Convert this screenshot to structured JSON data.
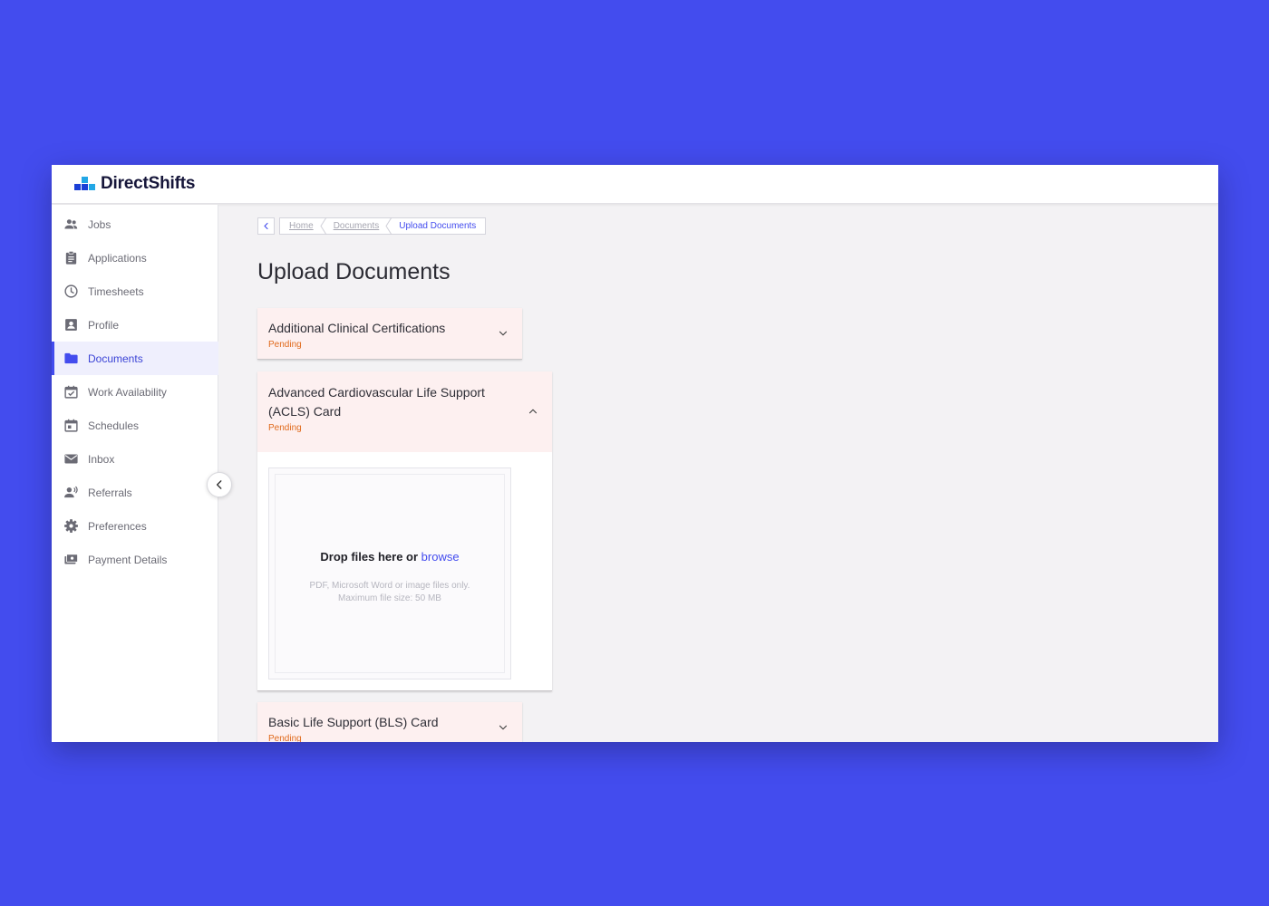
{
  "app": {
    "brand": "DirectShifts"
  },
  "sidebar": {
    "items": [
      {
        "label": "Jobs",
        "icon": "people-icon"
      },
      {
        "label": "Applications",
        "icon": "clipboard-icon"
      },
      {
        "label": "Timesheets",
        "icon": "clock-icon"
      },
      {
        "label": "Profile",
        "icon": "profile-icon"
      },
      {
        "label": "Documents",
        "icon": "folder-icon",
        "active": true
      },
      {
        "label": "Work Availability",
        "icon": "calendar-check-icon"
      },
      {
        "label": "Schedules",
        "icon": "calendar-icon"
      },
      {
        "label": "Inbox",
        "icon": "mail-icon"
      },
      {
        "label": "Referrals",
        "icon": "referral-icon"
      },
      {
        "label": "Preferences",
        "icon": "gear-icon"
      },
      {
        "label": "Payment Details",
        "icon": "payment-icon"
      }
    ]
  },
  "breadcrumb": {
    "home": "Home",
    "documents": "Documents",
    "current": "Upload Documents"
  },
  "page": {
    "title": "Upload Documents"
  },
  "documents": [
    {
      "title": "Additional Clinical Certifications",
      "status": "Pending",
      "expanded": false
    },
    {
      "title_line1": "Advanced Cardiovascular Life Support",
      "title_line2": "(ACLS) Card",
      "status": "Pending",
      "expanded": true
    },
    {
      "title": "Basic Life Support (BLS) Card",
      "status": "Pending",
      "expanded": false
    }
  ],
  "upload": {
    "drop_text": "Drop files here or",
    "browse_label": "browse",
    "hint_line1": "PDF, Microsoft Word or image files only.",
    "hint_line2": "Maximum file size: 50 MB"
  },
  "colors": {
    "background": "#434cee",
    "accent": "#434cee",
    "pending": "#e06a1c",
    "card": "#fdf0f0",
    "logo_blue": "#1b3fd6",
    "logo_cyan": "#22a7e6"
  }
}
